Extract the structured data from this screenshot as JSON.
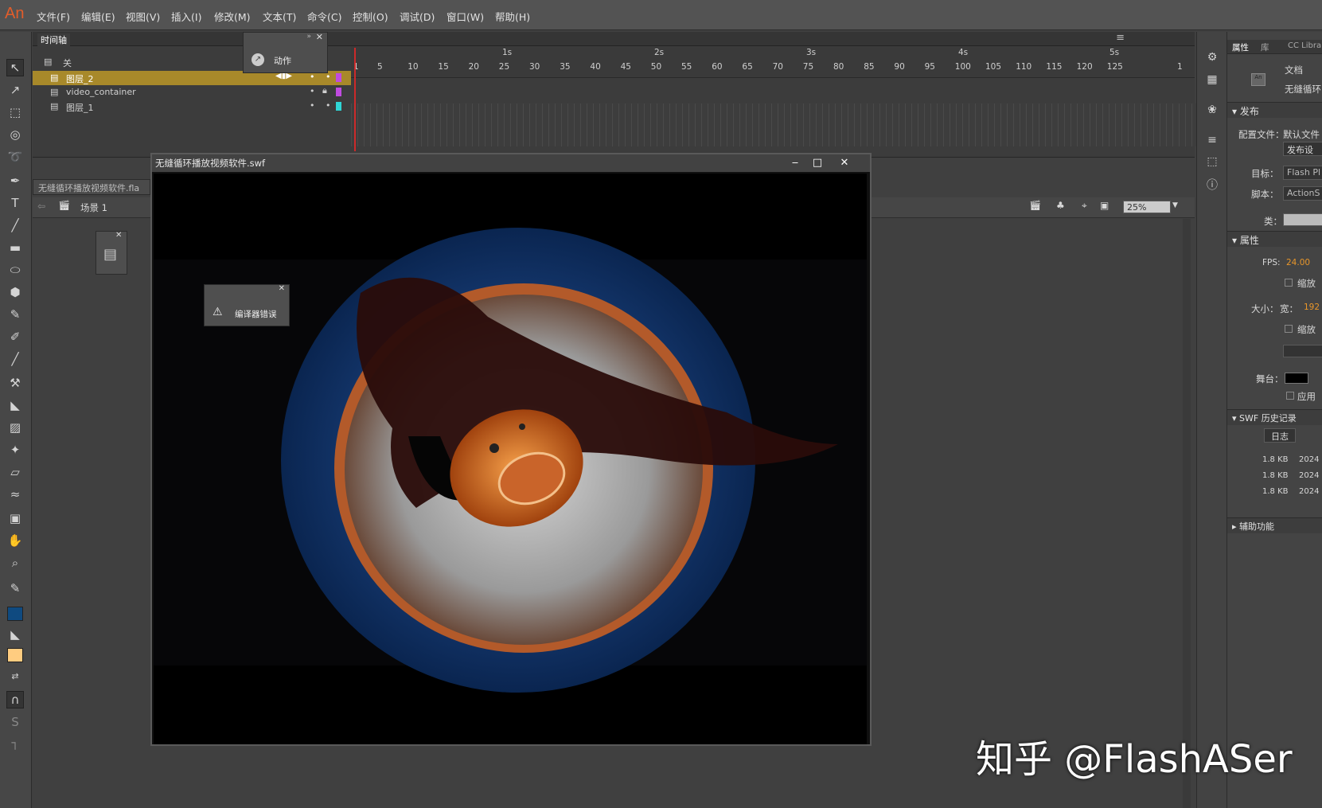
{
  "app": {
    "logo": "An"
  },
  "menu": [
    "文件(F)",
    "编辑(E)",
    "视图(V)",
    "插入(I)",
    "修改(M)",
    "文本(T)",
    "命令(C)",
    "控制(O)",
    "调试(D)",
    "窗口(W)",
    "帮助(H)"
  ],
  "timeline": {
    "panel_title": "时间轴",
    "header_label": "关",
    "layers": [
      {
        "name": "图层_2",
        "active": true
      },
      {
        "name": "video_container",
        "active": false
      },
      {
        "name": "图层_1",
        "active": false
      }
    ],
    "seconds": [
      "1s",
      "2s",
      "3s",
      "4s",
      "5s"
    ],
    "frames": [
      "1",
      "5",
      "10",
      "15",
      "20",
      "25",
      "30",
      "35",
      "40",
      "45",
      "50",
      "55",
      "60",
      "65",
      "70",
      "75",
      "80",
      "85",
      "90",
      "95",
      "100",
      "105",
      "110",
      "115",
      "120",
      "125",
      "1"
    ]
  },
  "actions_panel": {
    "label": "动作"
  },
  "document": {
    "tab": "无缝循环播放视频软件.fla",
    "scene": "场景 1",
    "zoom": "25%"
  },
  "swf_window": {
    "title": "无缝循环播放视频软件.swf"
  },
  "error_panel": {
    "label": "编译器错误"
  },
  "properties": {
    "tabs": [
      "属性",
      "库",
      "CC Librar"
    ],
    "doc_label": "文档",
    "doc_name": "无缝循环",
    "publish_section": "发布",
    "profile_label": "配置文件：",
    "profile_value": "默认文件",
    "publish_settings_button": "发布设",
    "target_label": "目标：",
    "target_value": "Flash Pl",
    "script_label": "脚本：",
    "script_value": "ActionS",
    "class_label": "类：",
    "props_section": "属性",
    "fps_label": "FPS:",
    "fps_value": "24.00",
    "scale_label": "缩放",
    "size_label": "大小：",
    "width_label": "宽：",
    "width_value": "192",
    "scale_label2": "缩放",
    "stage_label": "舞台：",
    "stage_color": "#000000",
    "apply_label": "应用",
    "swf_history_section": "SWF 历史记录",
    "log_button": "日志",
    "history": [
      {
        "size": "1.8 KB",
        "date": "2024"
      },
      {
        "size": "1.8 KB",
        "date": "2024"
      },
      {
        "size": "1.8 KB",
        "date": "2024"
      }
    ],
    "accessibility_section": "辅助功能"
  },
  "watermark": "知乎 @FlashASer",
  "colors": {
    "stroke": "#0f4a80",
    "fill": "#ffcc80",
    "active_layer": "#a8892a",
    "accent": "#e8962a"
  }
}
